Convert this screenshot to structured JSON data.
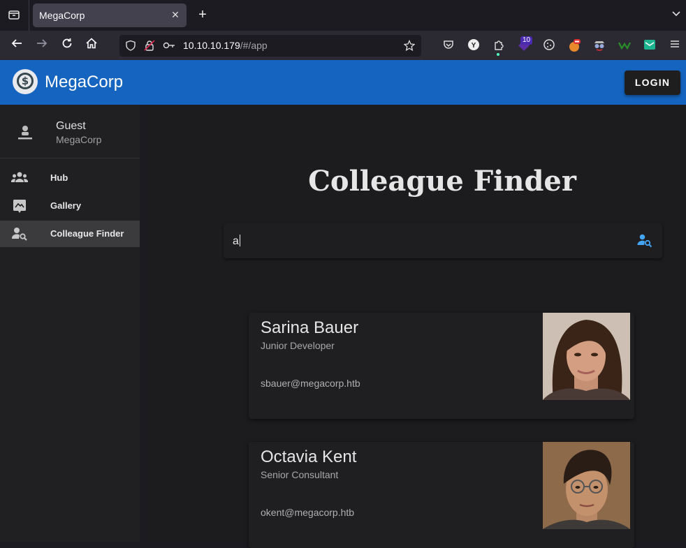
{
  "browser": {
    "tab_title": "MegaCorp",
    "url_host": "10.10.10.179",
    "url_path": "/#/app",
    "extension_badge": "10"
  },
  "app": {
    "brand": "MegaCorp",
    "login_label": "LOGIN",
    "brand_color": "#1565c0"
  },
  "sidebar": {
    "user_name": "Guest",
    "user_org": "MegaCorp",
    "items": [
      {
        "label": "Hub",
        "icon": "group-icon",
        "active": false
      },
      {
        "label": "Gallery",
        "icon": "gallery-icon",
        "active": false
      },
      {
        "label": "Colleague Finder",
        "icon": "person-search-icon",
        "active": true
      }
    ]
  },
  "main": {
    "title": "Colleague Finder",
    "search_value": "a",
    "results": [
      {
        "name": "Sarina Bauer",
        "role": "Junior Developer",
        "email": "sbauer@megacorp.htb",
        "photo": "woman-portrait"
      },
      {
        "name": "Octavia Kent",
        "role": "Senior Consultant",
        "email": "okent@megacorp.htb",
        "photo": "man-portrait-glasses"
      }
    ]
  }
}
